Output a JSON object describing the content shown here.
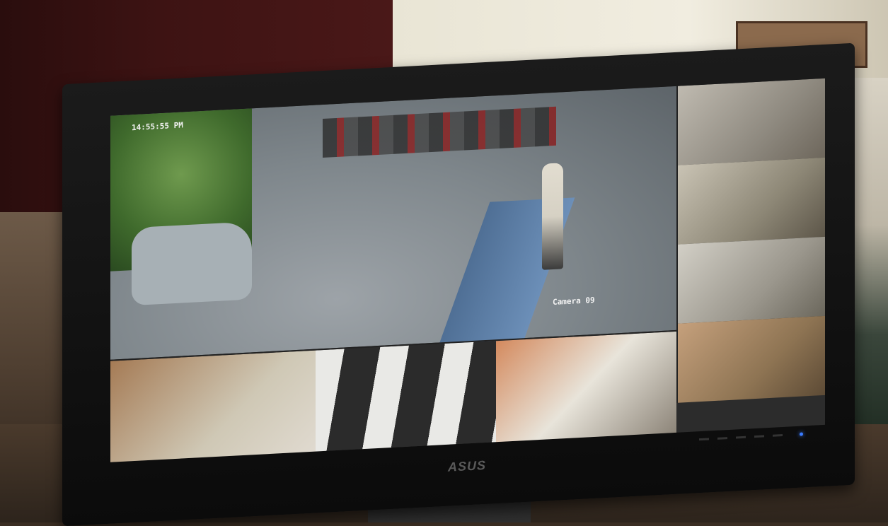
{
  "scene": {
    "caption": "CCTV monitor displaying multi-camera grid",
    "colors": {
      "curtain": "#3d1313",
      "wall": "#f1ede0",
      "bezel": "#0b0b0b",
      "power_led": "#3a7bff"
    }
  },
  "monitor": {
    "brand": "ASUS",
    "power_icon": "power-led-icon"
  },
  "cctv": {
    "main_camera": {
      "label": "Camera 09",
      "timestamp": "14:55:55 PM"
    },
    "grid": {
      "side_cameras": 4,
      "bottom_cameras": 3
    }
  }
}
